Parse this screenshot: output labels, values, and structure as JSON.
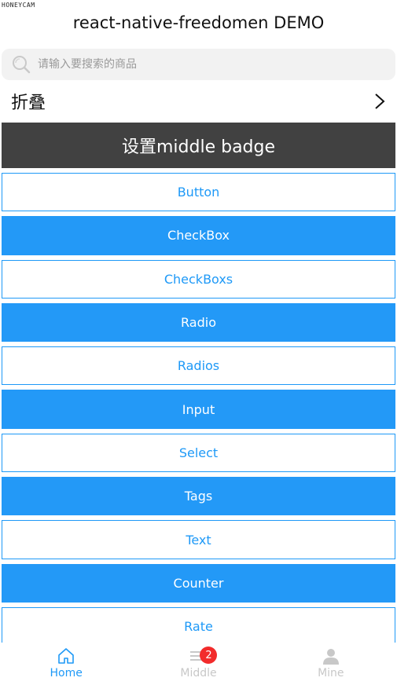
{
  "watermark": "HONEYCAM",
  "header": {
    "title": "react-native-freedomen DEMO"
  },
  "search": {
    "placeholder": "请输入要搜索的商品"
  },
  "collapse": {
    "label": "折叠"
  },
  "badge_bar": {
    "label": "设置middle  badge"
  },
  "buttons": [
    {
      "label": "Button",
      "style": "outline"
    },
    {
      "label": "CheckBox",
      "style": "filled"
    },
    {
      "label": "CheckBoxs",
      "style": "outline"
    },
    {
      "label": "Radio",
      "style": "filled"
    },
    {
      "label": "Radios",
      "style": "outline"
    },
    {
      "label": "Input",
      "style": "filled"
    },
    {
      "label": "Select",
      "style": "outline"
    },
    {
      "label": "Tags",
      "style": "filled"
    },
    {
      "label": "Text",
      "style": "outline"
    },
    {
      "label": "Counter",
      "style": "filled"
    },
    {
      "label": "Rate",
      "style": "outline"
    }
  ],
  "tabbar": {
    "tabs": [
      {
        "label": "Home",
        "icon": "home-icon",
        "active": true
      },
      {
        "label": "Middle",
        "icon": "menu-icon",
        "active": false,
        "badge": "2"
      },
      {
        "label": "Mine",
        "icon": "user-icon",
        "active": false
      }
    ]
  },
  "colors": {
    "accent": "#1e99f7",
    "dark_bar": "#414141",
    "badge": "#f22b2b"
  }
}
